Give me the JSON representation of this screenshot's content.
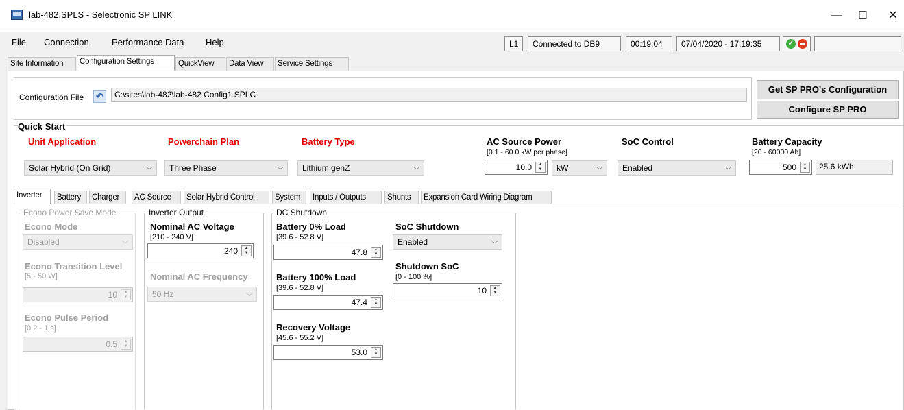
{
  "window": {
    "title": "lab-482.SPLS - Selectronic SP LINK",
    "minimize": "—",
    "maximize": "☐",
    "close": "✕"
  },
  "menu": [
    "File",
    "Connection",
    "Performance Data",
    "Help"
  ],
  "status": {
    "line": "L1",
    "connection": "Connected to DB9",
    "elapsed": "00:19:04",
    "datetime": "07/04/2020 - 17:19:35"
  },
  "main_tabs": [
    "Site Information",
    "Configuration Settings",
    "QuickView",
    "Data View",
    "Service Settings"
  ],
  "config": {
    "label": "Configuration File",
    "path": "C:\\sites\\lab-482\\lab-482 Config1.SPLC",
    "get_button": "Get SP PRO's Configuration",
    "configure_button": "Configure SP PRO"
  },
  "quick_start": {
    "title": "Quick Start",
    "unit_application": {
      "label": "Unit Application",
      "value": "Solar Hybrid (On Grid)"
    },
    "powerchain_plan": {
      "label": "Powerchain Plan",
      "value": "Three Phase"
    },
    "battery_type": {
      "label": "Battery Type",
      "value": "Lithium genZ"
    },
    "ac_source_power": {
      "label": "AC Source Power",
      "range": "[0.1 - 60.0 kW per phase]",
      "value": "10.0",
      "unit": "kW"
    },
    "soc_control": {
      "label": "SoC Control",
      "value": "Enabled"
    },
    "battery_capacity": {
      "label": "Battery Capacity",
      "range": "[20 - 60000 Ah]",
      "value": "500",
      "kwh": "25.6 kWh"
    }
  },
  "sub_tabs": [
    "Inverter",
    "Battery",
    "Charger",
    "AC Source",
    "Solar Hybrid Control",
    "System",
    "Inputs / Outputs",
    "Shunts",
    "Expansion Card Wiring Diagram"
  ],
  "econo": {
    "group": "Econo Power Save Mode",
    "mode_label": "Econo Mode",
    "mode_value": "Disabled",
    "transition_label": "Econo Transition Level",
    "transition_range": "[5 - 50 W]",
    "transition_value": "10",
    "pulse_label": "Econo Pulse Period",
    "pulse_range": "[0.2 - 1 s]",
    "pulse_value": "0.5"
  },
  "inverter_output": {
    "group": "Inverter Output",
    "voltage_label": "Nominal AC Voltage",
    "voltage_range": "[210 - 240 V]",
    "voltage_value": "240",
    "freq_label": "Nominal AC Frequency",
    "freq_value": "50 Hz"
  },
  "dc_shutdown": {
    "group": "DC Shutdown",
    "b0_label": "Battery 0% Load",
    "b0_range": "[39.6 - 52.8 V]",
    "b0_value": "47.8",
    "b100_label": "Battery 100% Load",
    "b100_range": "[39.6 - 52.8 V]",
    "b100_value": "47.4",
    "rec_label": "Recovery Voltage",
    "rec_range": "[45.6 - 55.2 V]",
    "rec_value": "53.0",
    "soc_sd_label": "SoC Shutdown",
    "soc_sd_value": "Enabled",
    "sd_soc_label": "Shutdown SoC",
    "sd_soc_range": "[0 - 100 %]",
    "sd_soc_value": "10"
  }
}
